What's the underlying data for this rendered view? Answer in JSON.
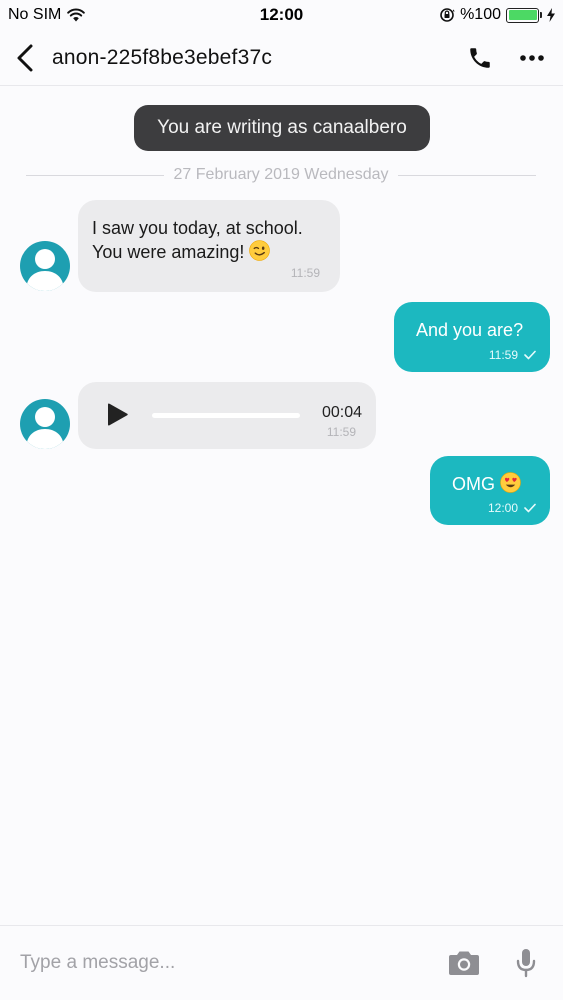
{
  "status_bar": {
    "carrier": "No SIM",
    "time": "12:00",
    "battery_text": "%100"
  },
  "header": {
    "title": "anon-225f8be3ebef37c"
  },
  "writing_as": "You are writing as canaalbero",
  "date_divider": "27 February 2019 Wednesday",
  "messages": [
    {
      "direction": "in",
      "lines": [
        "I saw you today, at school.",
        "You were amazing!"
      ],
      "emoji": "wink-emoji",
      "time": "11:59"
    },
    {
      "direction": "out",
      "text": "And you are?",
      "time": "11:59"
    },
    {
      "direction": "in",
      "type": "voice",
      "duration": "00:04",
      "time": "11:59"
    },
    {
      "direction": "out",
      "text": "OMG",
      "emoji": "heart-eyes-emoji",
      "time": "12:00"
    }
  ],
  "input": {
    "placeholder": "Type a message..."
  },
  "colors": {
    "accent": "#1cb8c0",
    "avatar": "#1e9fb1",
    "incoming_bubble": "#ebebed",
    "pill": "#3d3d3f",
    "battery": "#4cd964"
  }
}
